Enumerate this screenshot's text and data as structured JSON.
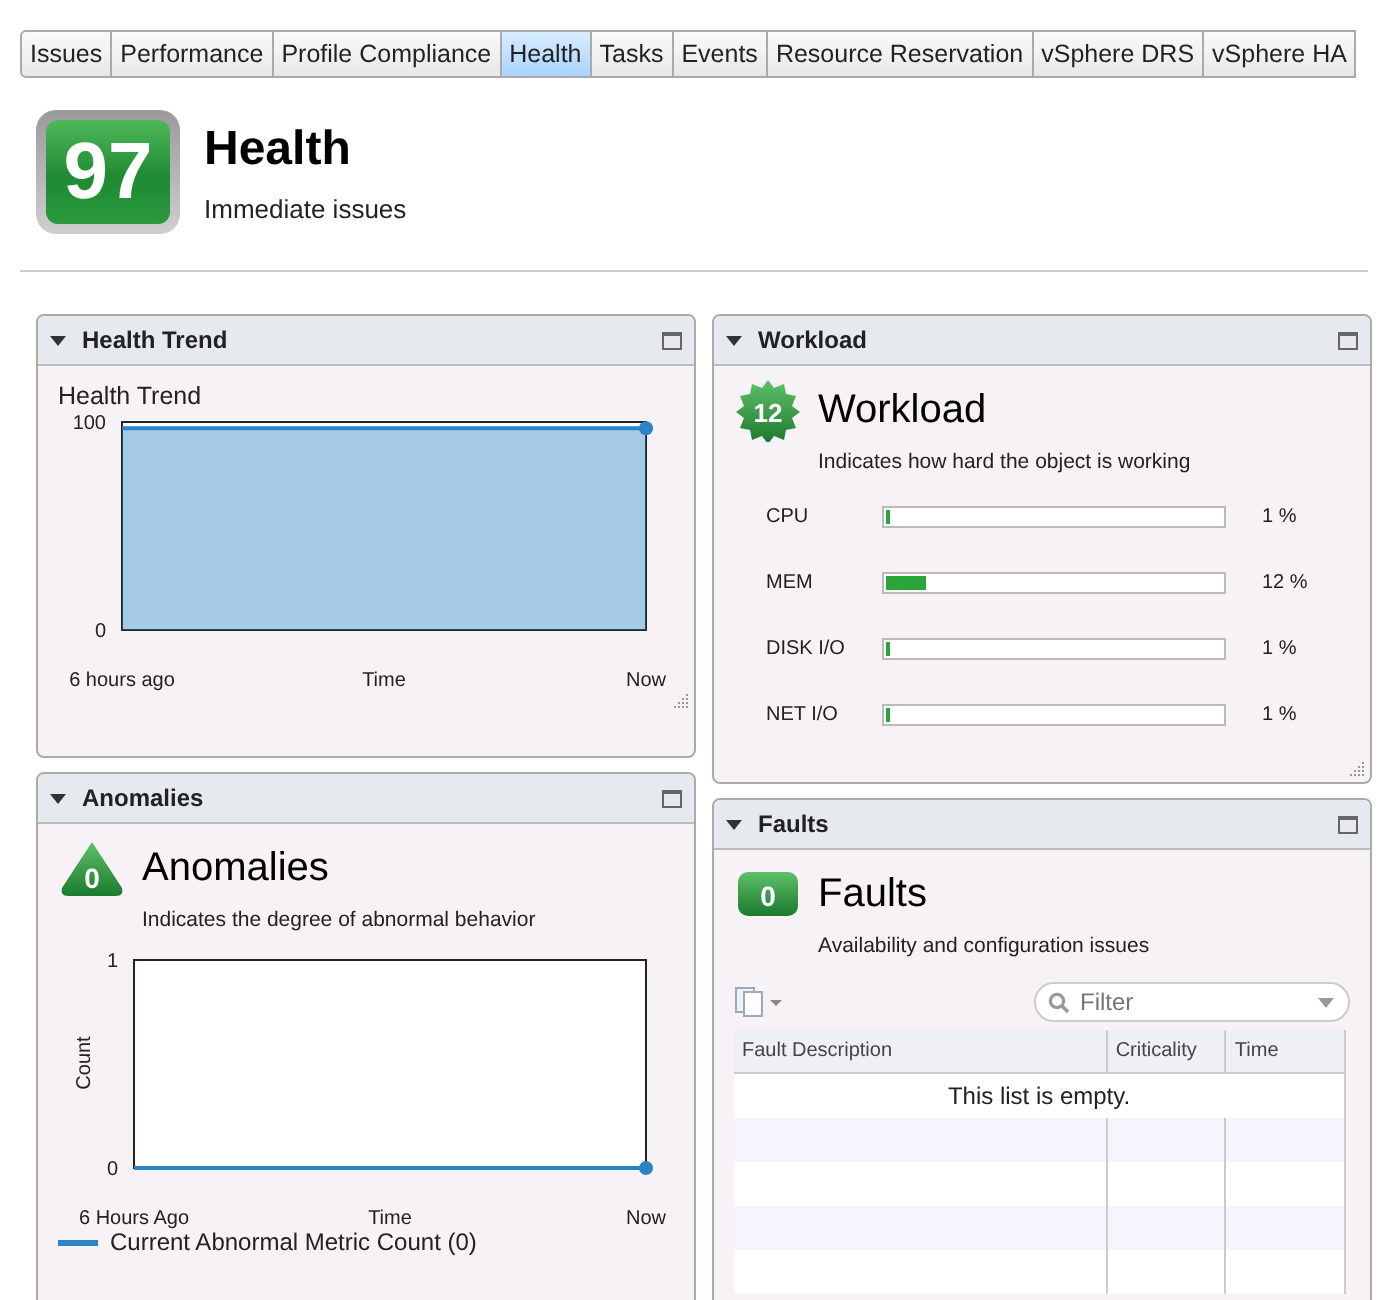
{
  "tabs": [
    {
      "label": "Issues",
      "selected": false
    },
    {
      "label": "Performance",
      "selected": false
    },
    {
      "label": "Profile Compliance",
      "selected": false
    },
    {
      "label": "Health",
      "selected": true
    },
    {
      "label": "Tasks",
      "selected": false
    },
    {
      "label": "Events",
      "selected": false
    },
    {
      "label": "Resource Reservation",
      "selected": false
    },
    {
      "label": "vSphere DRS",
      "selected": false
    },
    {
      "label": "vSphere HA",
      "selected": false
    }
  ],
  "header": {
    "score": "97",
    "title": "Health",
    "subtitle": "Immediate issues"
  },
  "health_trend": {
    "panel_title": "Health Trend",
    "chart_title": "Health Trend",
    "chart_data": {
      "type": "area",
      "categories": [
        "6 hours ago",
        "Now"
      ],
      "xlabel": "Time",
      "ylim": [
        0,
        100
      ],
      "yticks": [
        0,
        100
      ],
      "series": [
        {
          "color": "#2a84c6",
          "values": [
            97,
            97
          ]
        }
      ]
    }
  },
  "workload": {
    "panel_title": "Workload",
    "score": "12",
    "title": "Workload",
    "subtitle": "Indicates how hard the object is working",
    "metrics": [
      {
        "name": "CPU",
        "level": 0.01,
        "reading": "1 %"
      },
      {
        "name": "MEM",
        "level": 0.12,
        "reading": "12 %"
      },
      {
        "name": "DISK I/O",
        "level": 0.01,
        "reading": "1 %"
      },
      {
        "name": "NET I/O",
        "level": 0.01,
        "reading": "1 %"
      }
    ]
  },
  "anomalies": {
    "panel_title": "Anomalies",
    "score": "0",
    "title": "Anomalies",
    "subtitle": "Indicates the degree of abnormal behavior",
    "chart_data": {
      "type": "line",
      "categories": [
        "6 Hours Ago",
        "Now"
      ],
      "xlabel": "Time",
      "ylabel": "Count",
      "ylim": [
        0,
        1
      ],
      "yticks": [
        0,
        1
      ],
      "series": [
        {
          "name": "Current Abnormal Metric Count (0)",
          "color": "#2a84c6",
          "values": [
            0,
            0
          ]
        }
      ]
    }
  },
  "faults": {
    "panel_title": "Faults",
    "score": "0",
    "title": "Faults",
    "subtitle": "Availability and configuration issues",
    "filter_placeholder": "Filter",
    "columns": [
      "Fault Description",
      "Criticality",
      "Time"
    ],
    "empty_message": "This list is empty."
  }
}
